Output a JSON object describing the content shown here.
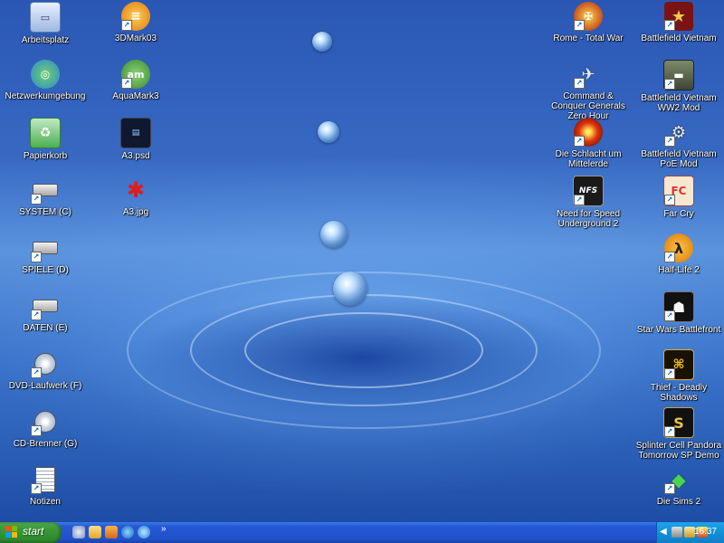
{
  "desktop": {
    "left_icons": [
      {
        "label": "Arbeitsplatz",
        "icon": "computer-icon"
      },
      {
        "label": "Netzwerkumgebung",
        "icon": "network-icon"
      },
      {
        "label": "Papierkorb",
        "icon": "recycle-bin-icon"
      },
      {
        "label": "SYSTEM (C)",
        "icon": "drive-icon"
      },
      {
        "label": "SPIELE (D)",
        "icon": "drive-icon"
      },
      {
        "label": "DATEN (E)",
        "icon": "drive-icon"
      },
      {
        "label": "DVD-Laufwerk (F)",
        "icon": "cd-drive-icon"
      },
      {
        "label": "CD-Brenner (G)",
        "icon": "cd-drive-icon"
      },
      {
        "label": "Notizen",
        "icon": "notepad-icon"
      }
    ],
    "second_col_icons": [
      {
        "label": "3DMark03",
        "icon": "3dmark-icon"
      },
      {
        "label": "AquaMark3",
        "icon": "aquamark-icon"
      },
      {
        "label": "A3.psd",
        "icon": "psd-file-icon"
      },
      {
        "label": "A3.jpg",
        "icon": "jpg-file-icon"
      }
    ],
    "right_col1_icons": [
      {
        "label": "Rome - Total War",
        "icon": "rome-icon"
      },
      {
        "label": "Command & Conquer Generals Zero Hour",
        "icon": "cnc-icon"
      },
      {
        "label": "Die Schlacht um Mittelerde",
        "icon": "eye-icon"
      },
      {
        "label": "Need for Speed Underground 2",
        "icon": "nfs-icon"
      }
    ],
    "right_col2_icons": [
      {
        "label": "Battlefield Vietnam",
        "icon": "star-icon"
      },
      {
        "label": "Battlefield Vietnam WW2 Mod",
        "icon": "tank-icon"
      },
      {
        "label": "Battlefield Vietnam PoE Mod",
        "icon": "helicopter-icon"
      },
      {
        "label": "Far Cry",
        "icon": "farcry-icon"
      },
      {
        "label": "Half-Life 2",
        "icon": "lambda-icon"
      },
      {
        "label": "Star Wars Battlefront",
        "icon": "stormtrooper-icon"
      },
      {
        "label": "Thief - Deadly Shadows",
        "icon": "thief-icon"
      },
      {
        "label": "Splinter Cell Pandora Tomorrow SP Demo",
        "icon": "splinter-icon"
      },
      {
        "label": "Die Sims 2",
        "icon": "sims-icon"
      }
    ]
  },
  "taskbar": {
    "start_label": "start",
    "quicklaunch_chevron": "»",
    "clock": "16:37"
  },
  "colors": {
    "taskbar_blue": "#2052cc",
    "start_green": "#3c9a3c",
    "tray_blue": "#1290d8"
  }
}
